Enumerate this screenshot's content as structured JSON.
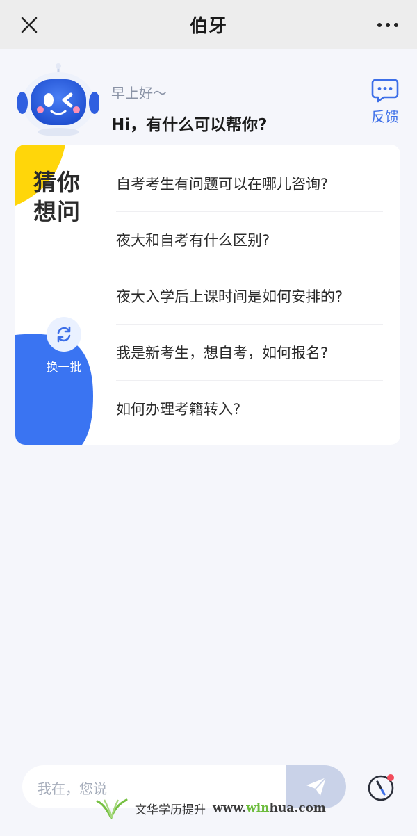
{
  "topbar": {
    "title": "伯牙",
    "close_icon": "close-icon",
    "more_icon": "more-dots-icon"
  },
  "greeting": {
    "sub": "早上好～",
    "main": "Hi，有什么可以帮你?"
  },
  "feedback": {
    "label": "反馈",
    "icon": "chat-bubble-icon"
  },
  "card": {
    "heading": "猜你想问",
    "refresh_label": "换一批",
    "questions": [
      "自考考生有问题可以在哪儿咨询?",
      "夜大和自考有什么区别?",
      "夜大入学后上课时间是如何安排的?",
      "我是新考生，想自考，如何报名?",
      "如何办理考籍转入?"
    ]
  },
  "input": {
    "placeholder": "我在，您说",
    "send_icon": "paper-plane-icon"
  },
  "compass_icon": "compass-icon",
  "watermark": {
    "text": "文华学历提升",
    "url_prefix": "www.",
    "url_accent": "win",
    "url_suffix": "hua.com"
  },
  "colors": {
    "accent": "#3d6fe8",
    "yellow": "#ffd60a",
    "blue": "#3a74f2",
    "send_bg": "#c9d2e8"
  }
}
